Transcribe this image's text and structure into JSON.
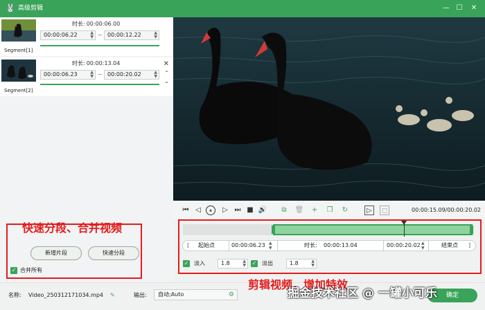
{
  "window": {
    "title": "高级剪辑",
    "icon": "app-logo-icon",
    "min_icon": "minimize-icon",
    "max_icon": "maximize-icon",
    "close_icon": "close-icon"
  },
  "segments": [
    {
      "label": "Segment[1]",
      "duration_label": "时长:",
      "duration": "00:00:06.00",
      "start": "00:00:06.22",
      "end": "00:00:12.22"
    },
    {
      "label": "Segment[2]",
      "duration_label": "时长:",
      "duration": "00:00:13.04",
      "start": "00:00:06.23",
      "end": "00:00:20.02"
    }
  ],
  "left_actions": {
    "add_segment": "新增片段",
    "quick_split": "快速分段",
    "merge_all": "合并所有"
  },
  "annotations": {
    "left": "快速分段、合并视频",
    "right": "剪辑视频，增加特效"
  },
  "player": {
    "time": "00:00:15.09/00:00:20.02"
  },
  "trim": {
    "start_btn": "起始点",
    "start_value": "00:00:06.23",
    "duration_label": "时长:",
    "duration_value": "00:00:13.04",
    "end_value": "00:00:20.02",
    "end_btn": "结束点",
    "selection_start_fraction": 0.31,
    "selection_end_fraction": 1.0,
    "playhead_fraction": 0.76
  },
  "fade": {
    "fade_in_label": "淡入",
    "fade_in_value": "1.8",
    "fade_out_label": "淡出",
    "fade_out_value": "1.8"
  },
  "bottom": {
    "name_label": "名称:",
    "file_name": "Video_250312171034.mp4",
    "output_label": "输出:",
    "output_value": "自动;Auto",
    "ok_label": "确定"
  },
  "watermark": "掘金技术社区 @ 一罐小可乐",
  "colors": {
    "accent": "#39a35a",
    "annotation": "#e31c1c"
  }
}
